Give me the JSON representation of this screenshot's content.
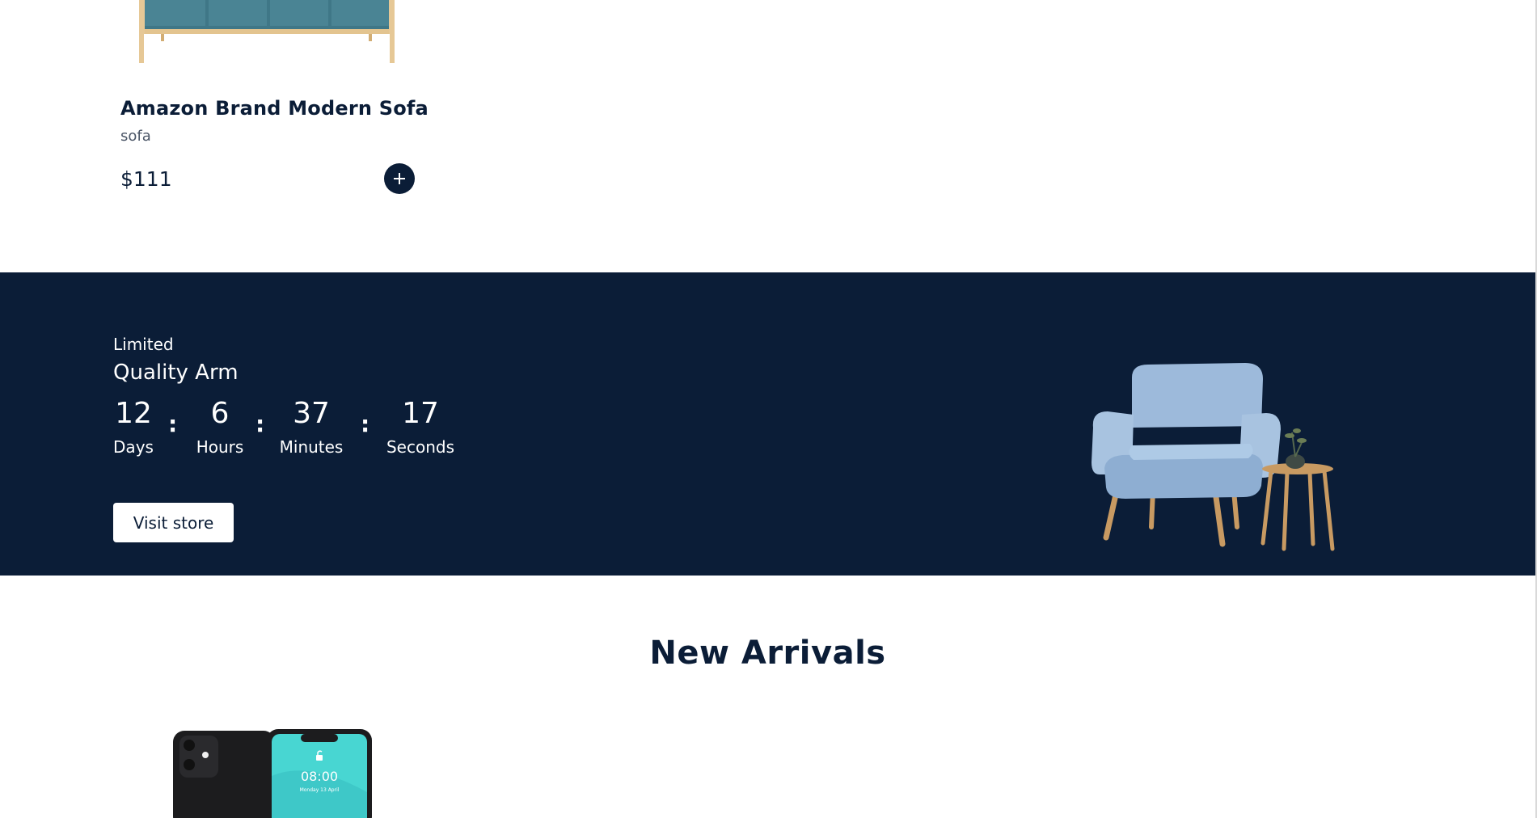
{
  "product": {
    "name": "Amazon Brand Modern Sofa",
    "category": "sofa",
    "price": "$111"
  },
  "promo": {
    "label": "Limited",
    "title": "Quality Arm",
    "countdown": [
      {
        "value": "12",
        "label": "Days"
      },
      {
        "value": "6",
        "label": "Hours"
      },
      {
        "value": "37",
        "label": "Minutes"
      },
      {
        "value": "17",
        "label": "Seconds"
      }
    ],
    "separator": ":",
    "button_label": "Visit store"
  },
  "new_arrivals": {
    "title": "New Arrivals",
    "phone_time": "08:00",
    "phone_date": "Monday 13 April"
  },
  "colors": {
    "navy": "#0b1d37",
    "white": "#ffffff",
    "sofa_fabric": "#3f7787",
    "armchair_blue": "#9dbadb",
    "phone_screen": "#48d6d2"
  },
  "icons": {
    "add_to_cart": "plus-icon"
  }
}
